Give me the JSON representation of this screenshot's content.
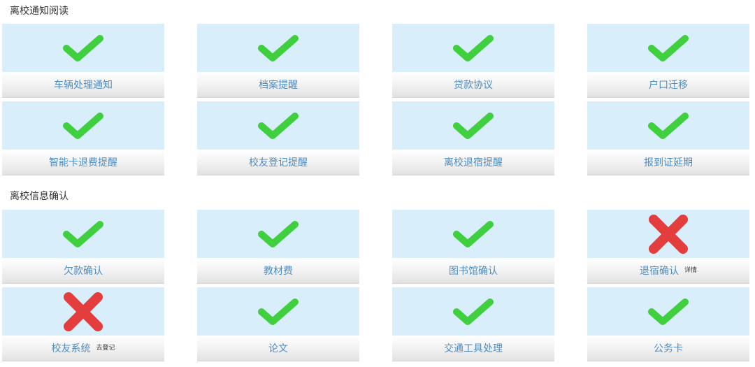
{
  "sections": [
    {
      "title": "离校通知阅读",
      "items": [
        {
          "label": "车辆处理通知",
          "status": "check-icon"
        },
        {
          "label": "档案提醒",
          "status": "check-icon"
        },
        {
          "label": "贷款协议",
          "status": "check-icon"
        },
        {
          "label": "户口迁移",
          "status": "check-icon"
        },
        {
          "label": "智能卡退费提醒",
          "status": "check-icon"
        },
        {
          "label": "校友登记提醒",
          "status": "check-icon"
        },
        {
          "label": "离校退宿提醒",
          "status": "check-icon"
        },
        {
          "label": "报到证延期",
          "status": "check-icon"
        }
      ]
    },
    {
      "title": "离校信息确认",
      "items": [
        {
          "label": "欠款确认",
          "status": "check-icon"
        },
        {
          "label": "教材费",
          "status": "check-icon"
        },
        {
          "label": "图书馆确认",
          "status": "check-icon"
        },
        {
          "label": "退宿确认",
          "status": "cross-icon",
          "extra": "详情"
        },
        {
          "label": "校友系统",
          "status": "cross-icon",
          "extra": "去登记"
        },
        {
          "label": "论文",
          "status": "check-icon"
        },
        {
          "label": "交通工具处理",
          "status": "check-icon"
        },
        {
          "label": "公务卡",
          "status": "check-icon"
        }
      ]
    }
  ],
  "colors": {
    "check": "#3fcf3f",
    "cross": "#e33d3d",
    "tile_bg": "#d9eefb",
    "label": "#4d8cc2"
  }
}
